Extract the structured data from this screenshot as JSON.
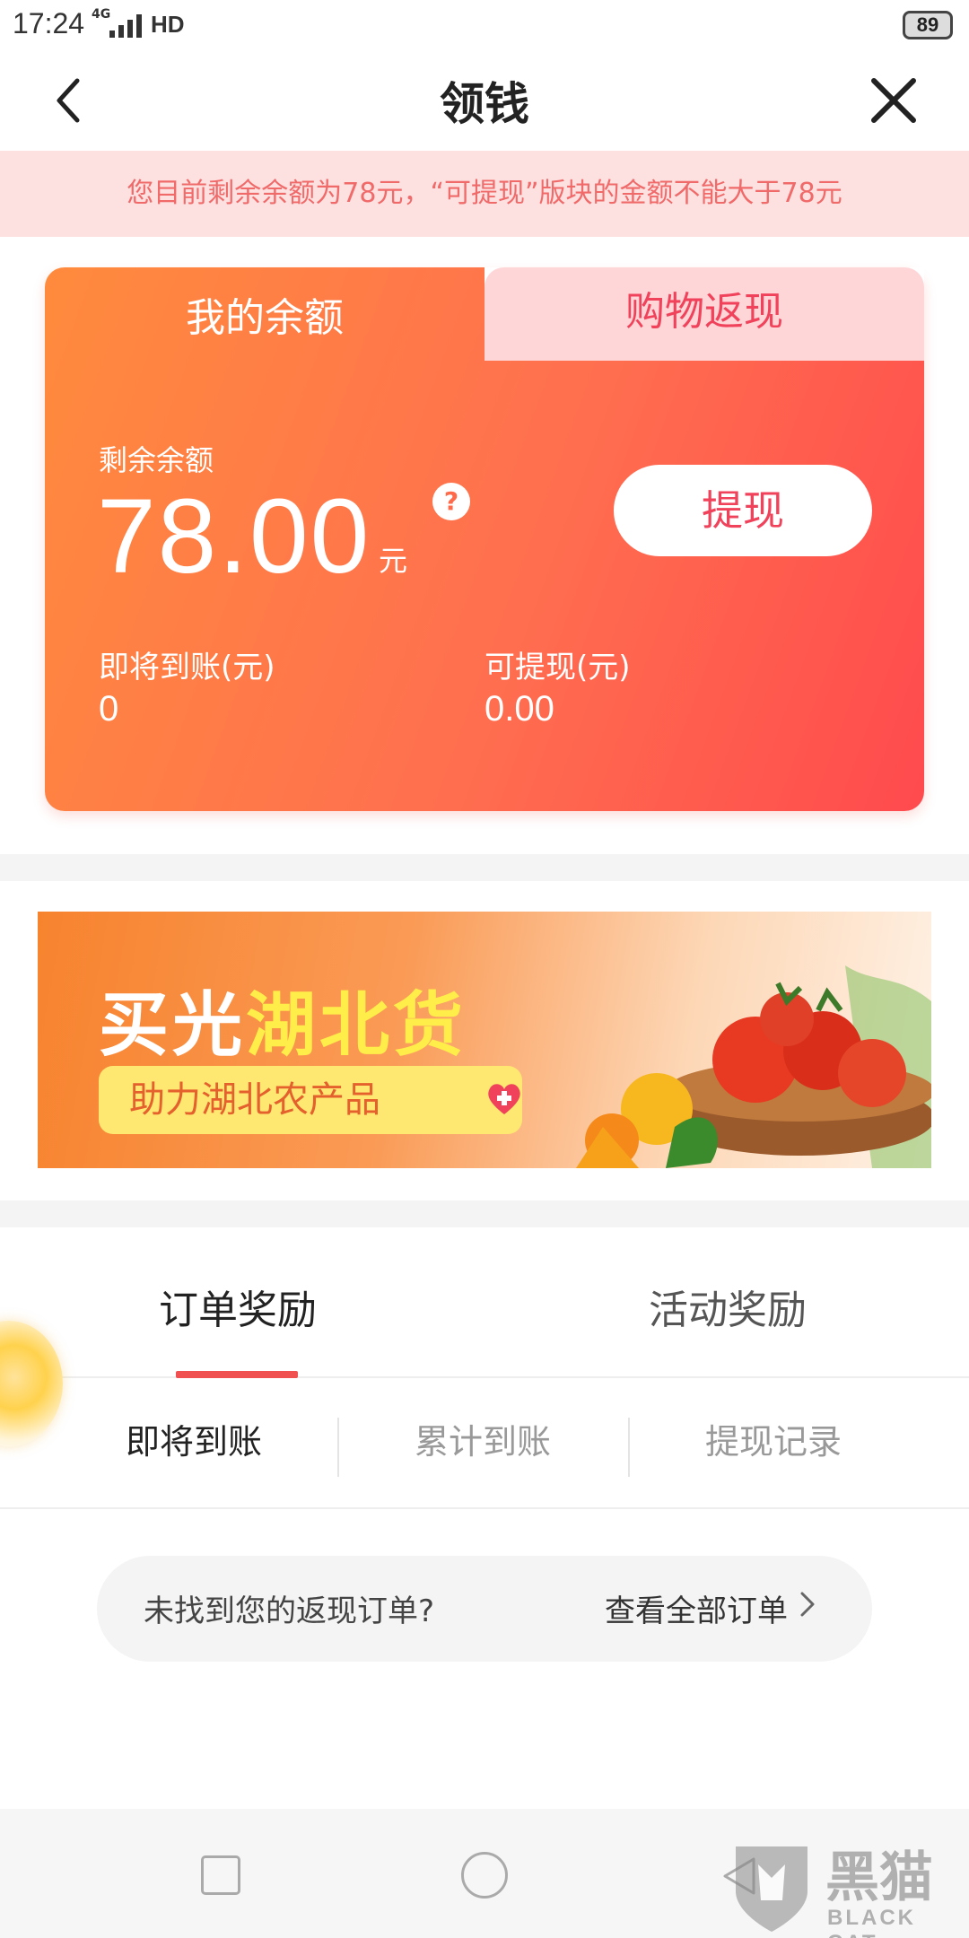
{
  "status_bar": {
    "time": "17:24",
    "network": "4G",
    "hd": "HD",
    "battery": "89"
  },
  "nav": {
    "title": "领钱",
    "back_icon": "chevron-left-icon",
    "close_icon": "close-icon"
  },
  "notice": "您目前剩余余额为78元，“可提现”版块的金额不能大于78元",
  "balance_card": {
    "tabs": [
      {
        "label": "我的余额",
        "active": true
      },
      {
        "label": "购物返现",
        "active": false
      }
    ],
    "balance_label": "剩余余额",
    "balance_value": "78.00",
    "balance_unit": "元",
    "help_icon": "?",
    "withdraw_button": "提现",
    "pending_label": "即将到账(元)",
    "pending_value": "0",
    "withdrawable_label": "可提现(元)",
    "withdrawable_value": "0.00",
    "colors": {
      "gradient_start": "#ff8b3d",
      "gradient_end": "#ff4a4e",
      "inactive_tab": "#ffd6d8"
    }
  },
  "banner": {
    "title_white": "买光",
    "title_yellow": "湖北货",
    "subtitle": "助力湖北农产品"
  },
  "reward_tabs": [
    {
      "label": "订单奖励",
      "active": true
    },
    {
      "label": "活动奖励",
      "active": false
    }
  ],
  "sub_tabs": [
    {
      "label": "即将到账",
      "active": true
    },
    {
      "label": "累计到账",
      "active": false
    },
    {
      "label": "提现记录",
      "active": false
    }
  ],
  "not_found": {
    "text": "未找到您的返现订单?",
    "link": "查看全部订单"
  },
  "system_nav": {
    "icons": [
      "square-icon",
      "home-circle-icon",
      "back-triangle-icon"
    ]
  },
  "watermark": {
    "cn": "黑猫",
    "en": "BLACK CAT"
  }
}
